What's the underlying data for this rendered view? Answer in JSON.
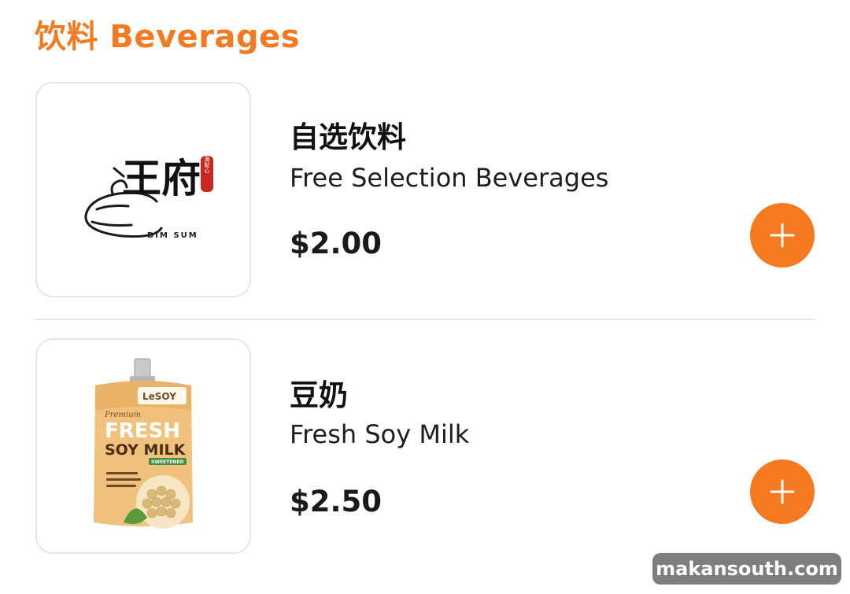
{
  "section": {
    "title": "饮料 Beverages",
    "accent_color": "#f27a21"
  },
  "items": [
    {
      "name_cn": "自选饮料",
      "name_en": "Free Selection Beverages",
      "price": "$2.00",
      "image": {
        "type": "restaurant-logo",
        "icon": "dim-sum-logo",
        "logo_main": "王府",
        "logo_sub": "DIM SUM",
        "logo_seal": "上海點心"
      },
      "add_icon": "plus-icon"
    },
    {
      "name_cn": "豆奶",
      "name_en": "Fresh Soy Milk",
      "price": "$2.50",
      "image": {
        "type": "product-photo",
        "icon": "soy-milk-pouch",
        "brand": "LeSOY",
        "premium": "Premium",
        "line1": "FRESH",
        "line2": "SOY MILK",
        "badge": "SWEETENED"
      },
      "add_icon": "plus-icon"
    }
  ],
  "watermark": "makansouth.com"
}
